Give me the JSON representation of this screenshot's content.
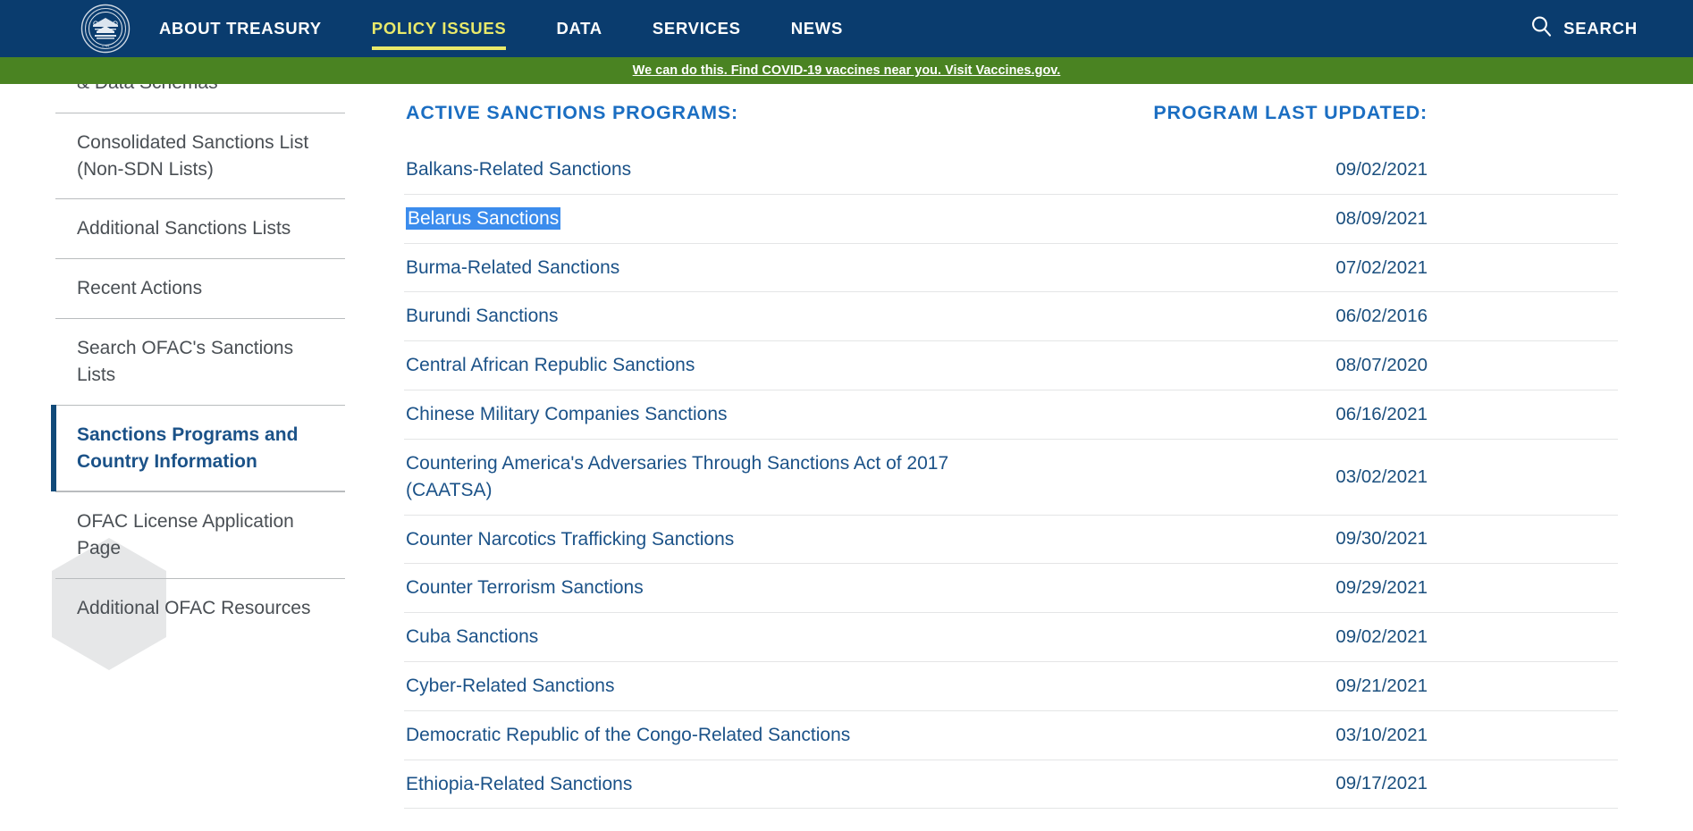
{
  "header": {
    "logo_alt": "U.S. Department of the Treasury seal",
    "nav": [
      {
        "label": "ABOUT TREASURY",
        "active": false
      },
      {
        "label": "POLICY ISSUES",
        "active": true
      },
      {
        "label": "DATA",
        "active": false
      },
      {
        "label": "SERVICES",
        "active": false
      },
      {
        "label": "NEWS",
        "active": false
      }
    ],
    "search_label": "SEARCH",
    "accent_active": "#e9e96a",
    "background": "#0a3c6e"
  },
  "covid_banner": {
    "text": "We can do this. Find COVID-19 vaccines near you. Visit Vaccines.gov.",
    "background": "#4a8322"
  },
  "sidebar": {
    "items": [
      {
        "label": "& Data Schemas",
        "active": false
      },
      {
        "label": "Consolidated Sanctions List (Non-SDN Lists)",
        "active": false
      },
      {
        "label": "Additional Sanctions Lists",
        "active": false
      },
      {
        "label": "Recent Actions",
        "active": false
      },
      {
        "label": "Search OFAC's Sanctions Lists",
        "active": false
      },
      {
        "label": "Sanctions Programs and Country Information",
        "active": true
      },
      {
        "label": "OFAC License Application Page",
        "active": false
      },
      {
        "label": "Additional OFAC Resources",
        "active": false
      }
    ],
    "active_accent": "#114a79",
    "active_background": "#eef0f1"
  },
  "main": {
    "columns": {
      "program": "ACTIVE SANCTIONS PROGRAMS:",
      "updated": "PROGRAM LAST UPDATED:"
    },
    "selection_color": "#3b8ced",
    "rows": [
      {
        "name": "Balkans-Related Sanctions",
        "updated": "09/02/2021",
        "selected": false
      },
      {
        "name": "Belarus Sanctions",
        "updated": "08/09/2021",
        "selected": true
      },
      {
        "name": "Burma-Related Sanctions",
        "updated": "07/02/2021",
        "selected": false
      },
      {
        "name": "Burundi Sanctions",
        "updated": "06/02/2016",
        "selected": false
      },
      {
        "name": "Central African Republic Sanctions",
        "updated": "08/07/2020",
        "selected": false
      },
      {
        "name": "Chinese Military Companies Sanctions",
        "updated": "06/16/2021",
        "selected": false
      },
      {
        "name": "Countering America's Adversaries Through Sanctions Act of 2017 (CAATSA)",
        "updated": "03/02/2021",
        "selected": false
      },
      {
        "name": "Counter Narcotics Trafficking Sanctions",
        "updated": "09/30/2021",
        "selected": false
      },
      {
        "name": "Counter Terrorism Sanctions",
        "updated": "09/29/2021",
        "selected": false
      },
      {
        "name": "Cuba Sanctions",
        "updated": "09/02/2021",
        "selected": false
      },
      {
        "name": "Cyber-Related Sanctions",
        "updated": "09/21/2021",
        "selected": false
      },
      {
        "name": "Democratic Republic of the Congo-Related Sanctions",
        "updated": "03/10/2021",
        "selected": false
      },
      {
        "name": "Ethiopia-Related Sanctions",
        "updated": "09/17/2021",
        "selected": false
      }
    ]
  }
}
